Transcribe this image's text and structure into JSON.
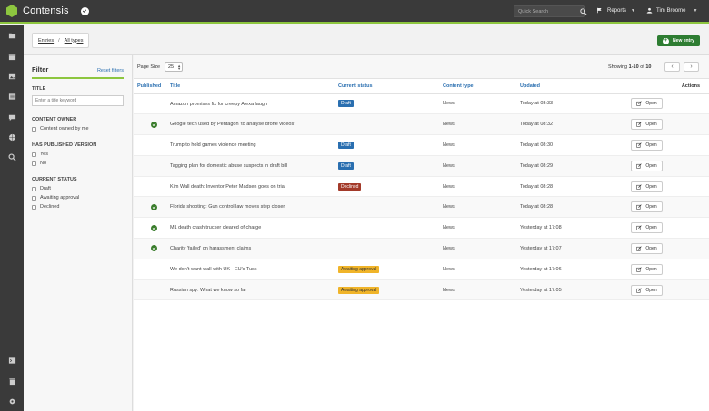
{
  "app": {
    "name": "Contensis"
  },
  "topbar": {
    "search_placeholder": "Quick Search",
    "reports_label": "Reports",
    "user_name": "Tim Broome"
  },
  "breadcrumb": {
    "root": "Entries",
    "separator": "/",
    "current": "All types"
  },
  "new_entry_label": "New entry",
  "filter": {
    "title": "Filter",
    "reset_label": "Reset filters",
    "sections": {
      "title_heading": "TITLE",
      "title_placeholder": "Enter a title keyword",
      "owner_heading": "CONTENT OWNER",
      "owner_option": "Content owned by me",
      "published_heading": "HAS PUBLISHED VERSION",
      "published_yes": "Yes",
      "published_no": "No",
      "status_heading": "CURRENT STATUS",
      "status_draft": "Draft",
      "status_awaiting": "Awaiting approval",
      "status_declined": "Declined"
    }
  },
  "pager": {
    "page_size_label": "Page Size",
    "page_size_value": "25",
    "showing_prefix": "Showing",
    "showing_range": "1-10",
    "showing_of": "of",
    "showing_total": "10",
    "prev_glyph": "‹",
    "next_glyph": "›"
  },
  "table": {
    "columns": {
      "published": "Published",
      "title": "Title",
      "status": "Current status",
      "type": "Content type",
      "updated": "Updated",
      "actions": "Actions"
    },
    "open_label": "Open",
    "rows": [
      {
        "published": false,
        "title": "Amazon promises fix for creepy Alexa laugh",
        "status": "Draft",
        "status_kind": "draft",
        "type": "News",
        "updated": "Today at 08:33"
      },
      {
        "published": true,
        "title": "Google tech used by Pentagon 'to analyse drone videos'",
        "status": "",
        "status_kind": "",
        "type": "News",
        "updated": "Today at 08:32"
      },
      {
        "published": false,
        "title": "Trump to hold games violence meeting",
        "status": "Draft",
        "status_kind": "draft",
        "type": "News",
        "updated": "Today at 08:30"
      },
      {
        "published": false,
        "title": "Tagging plan for domestic abuse suspects in draft bill",
        "status": "Draft",
        "status_kind": "draft",
        "type": "News",
        "updated": "Today at 08:29"
      },
      {
        "published": false,
        "title": "Kim Wall death: Inventor Peter Madsen goes on trial",
        "status": "Declined",
        "status_kind": "declined",
        "type": "News",
        "updated": "Today at 08:28"
      },
      {
        "published": true,
        "title": "Florida shooting: Gun control law moves step closer",
        "status": "",
        "status_kind": "",
        "type": "News",
        "updated": "Today at 08:28"
      },
      {
        "published": true,
        "title": "M1 death crash trucker cleared of charge",
        "status": "",
        "status_kind": "",
        "type": "News",
        "updated": "Yesterday at 17:08"
      },
      {
        "published": true,
        "title": "Charity 'failed' on harassment claims",
        "status": "",
        "status_kind": "",
        "type": "News",
        "updated": "Yesterday at 17:07"
      },
      {
        "published": false,
        "title": "We don't want wall with UK - EU's Tusk",
        "status": "Awaiting approval",
        "status_kind": "awaiting",
        "type": "News",
        "updated": "Yesterday at 17:06"
      },
      {
        "published": false,
        "title": "Russian spy: What we know so far",
        "status": "Awaiting approval",
        "status_kind": "awaiting",
        "type": "News",
        "updated": "Yesterday at 17:05"
      }
    ]
  },
  "colors": {
    "accent": "#8dc63f",
    "link": "#2a6fb0",
    "primary_button": "#2e7d32",
    "draft": "#2a6fb0",
    "declined": "#a33a2a",
    "awaiting": "#f0b429"
  }
}
